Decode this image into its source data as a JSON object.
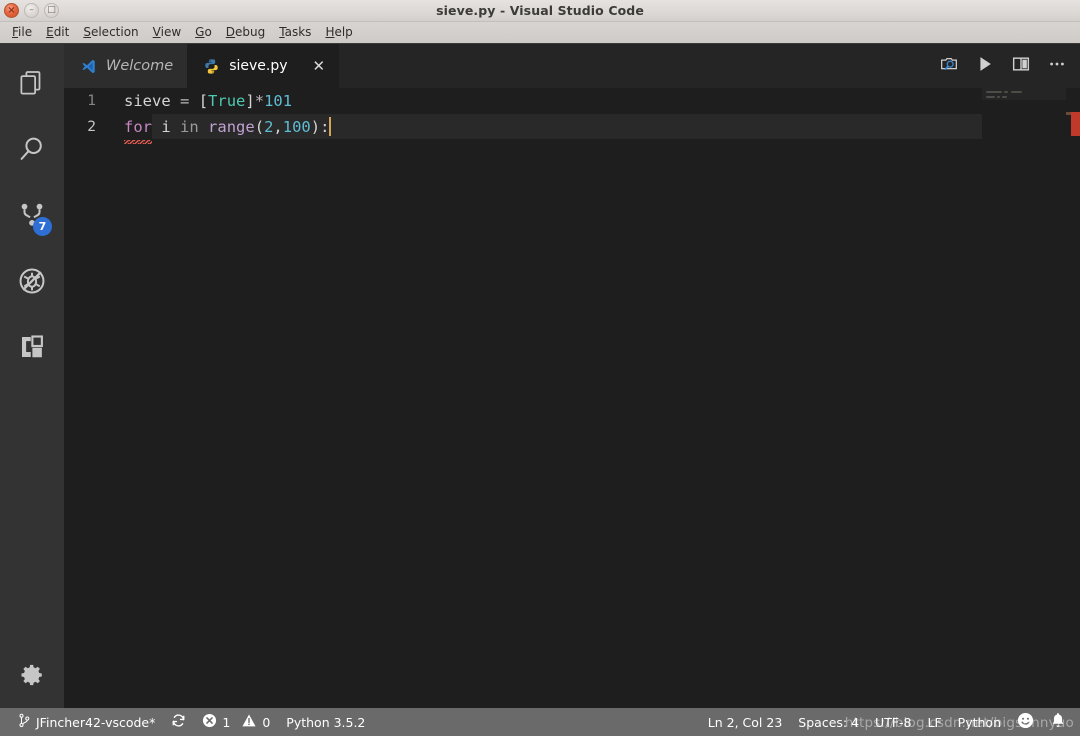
{
  "window": {
    "title": "sieve.py - Visual Studio Code",
    "controls": {
      "close": "×",
      "minimize": "–",
      "maximize": "□"
    }
  },
  "menubar": {
    "items": [
      {
        "name": "file",
        "mnemonic": "F",
        "rest": "ile"
      },
      {
        "name": "edit",
        "mnemonic": "E",
        "rest": "dit"
      },
      {
        "name": "selection",
        "mnemonic": "S",
        "rest": "election"
      },
      {
        "name": "view",
        "mnemonic": "V",
        "rest": "iew"
      },
      {
        "name": "go",
        "mnemonic": "G",
        "rest": "o"
      },
      {
        "name": "debug",
        "mnemonic": "D",
        "rest": "ebug"
      },
      {
        "name": "tasks",
        "mnemonic": "T",
        "rest": "asks"
      },
      {
        "name": "help",
        "mnemonic": "H",
        "rest": "elp"
      }
    ]
  },
  "activitybar": {
    "items": [
      {
        "icon": "files-icon",
        "label": "Explorer"
      },
      {
        "icon": "search-icon",
        "label": "Search"
      },
      {
        "icon": "source-control-icon",
        "label": "Source Control",
        "badge": "7"
      },
      {
        "icon": "debug-icon",
        "label": "Debug"
      },
      {
        "icon": "extensions-icon",
        "label": "Extensions"
      }
    ],
    "settings": {
      "icon": "gear-icon",
      "label": "Manage"
    }
  },
  "tabs": [
    {
      "label": "Welcome",
      "icon": "vscode-icon",
      "active": false,
      "closable": false
    },
    {
      "label": "sieve.py",
      "icon": "python-icon",
      "active": true,
      "closable": true,
      "close": "✕"
    }
  ],
  "editor_actions": [
    {
      "icon": "preview-icon",
      "label": "Open Preview"
    },
    {
      "icon": "run-icon",
      "label": "Run Python File"
    },
    {
      "icon": "split-editor-icon",
      "label": "Split Editor"
    },
    {
      "icon": "more-icon",
      "label": "More Actions..."
    }
  ],
  "code": {
    "lines": [
      {
        "number": "1",
        "current": false,
        "tokens": [
          {
            "text": "sieve",
            "type": "plain"
          },
          {
            "text": " ",
            "type": "plain"
          },
          {
            "text": "=",
            "type": "op"
          },
          {
            "text": " ",
            "type": "plain"
          },
          {
            "text": "[",
            "type": "punct"
          },
          {
            "text": "True",
            "type": "const"
          },
          {
            "text": "]",
            "type": "punct"
          },
          {
            "text": "*",
            "type": "op"
          },
          {
            "text": "101",
            "type": "num"
          }
        ]
      },
      {
        "number": "2",
        "current": true,
        "tokens": [
          {
            "text": "for",
            "type": "kw",
            "error": true
          },
          {
            "text": " ",
            "type": "plain"
          },
          {
            "text": "i",
            "type": "plain"
          },
          {
            "text": " ",
            "type": "plain"
          },
          {
            "text": "in",
            "type": "kw2"
          },
          {
            "text": " ",
            "type": "plain"
          },
          {
            "text": "range",
            "type": "fn"
          },
          {
            "text": "(",
            "type": "punct"
          },
          {
            "text": "2",
            "type": "num"
          },
          {
            "text": ",",
            "type": "punct"
          },
          {
            "text": "100",
            "type": "num"
          },
          {
            "text": ")",
            "type": "punct"
          },
          {
            "text": ":",
            "type": "punct"
          }
        ]
      }
    ]
  },
  "statusbar": {
    "left": [
      {
        "name": "git-branch",
        "icon": "branch-icon",
        "text": "JFincher42-vscode*"
      },
      {
        "name": "sync",
        "icon": "sync-icon",
        "text": ""
      },
      {
        "name": "errors",
        "icon": "error-icon",
        "text": "1"
      },
      {
        "name": "warnings",
        "icon": "warning-icon",
        "text": "0"
      },
      {
        "name": "python-version",
        "icon": "",
        "text": "Python 3.5.2"
      }
    ],
    "right": [
      {
        "name": "cursor-position",
        "text": "Ln 2, Col 23"
      },
      {
        "name": "indentation",
        "text": "Spaces: 4"
      },
      {
        "name": "encoding",
        "text": "UTF-8"
      },
      {
        "name": "eol",
        "text": "LF"
      },
      {
        "name": "language-mode",
        "text": "Python"
      },
      {
        "name": "feedback",
        "icon": "smiley-icon",
        "text": ""
      },
      {
        "name": "notifications",
        "icon": "bell-icon",
        "text": ""
      }
    ]
  },
  "watermark": {
    "text": "https://blog.csdn.net/bigsunnyuo"
  },
  "colors": {
    "titlebar_bg": "#ddd9d6",
    "menubar_bg": "#d3cfcc",
    "activitybar_bg": "#333333",
    "tabbar_bg": "#252526",
    "tab_active_bg": "#1e1e1e",
    "tab_inactive_bg": "#2d2d2d",
    "editor_bg": "#1e1e1e",
    "statusbar_bg": "#6a6a6a",
    "badge_bg": "#2d6fd4",
    "error_marker": "#c0392b",
    "caret": "#d7a357"
  }
}
